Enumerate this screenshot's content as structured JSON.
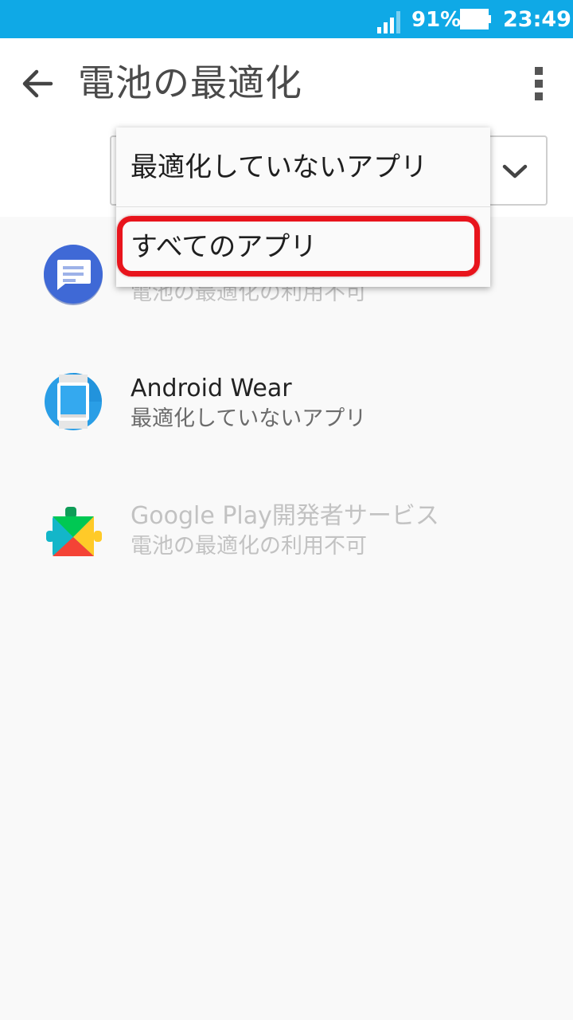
{
  "status_bar": {
    "battery_percent": "91%",
    "time": "23:49",
    "color": "#0fa9e6",
    "icons": [
      "signal-icon",
      "battery-icon"
    ]
  },
  "app_bar": {
    "title": "電池の最適化",
    "icons": [
      "back-arrow-icon",
      "more-vert-icon"
    ]
  },
  "filter": {
    "options": [
      {
        "label": "最適化していないアプリ"
      },
      {
        "label": "すべてのアプリ",
        "highlighted": true
      }
    ],
    "highlight_color": "#e8141c"
  },
  "apps": [
    {
      "name": "",
      "status": "電池の最適化の利用不可",
      "icon": "messages-icon",
      "enabled": false
    },
    {
      "name": "Android Wear",
      "status": "最適化していないアプリ",
      "icon": "android-wear-icon",
      "enabled": true
    },
    {
      "name": "Google Play開発者サービス",
      "status": "電池の最適化の利用不可",
      "icon": "google-play-services-icon",
      "enabled": false
    }
  ]
}
